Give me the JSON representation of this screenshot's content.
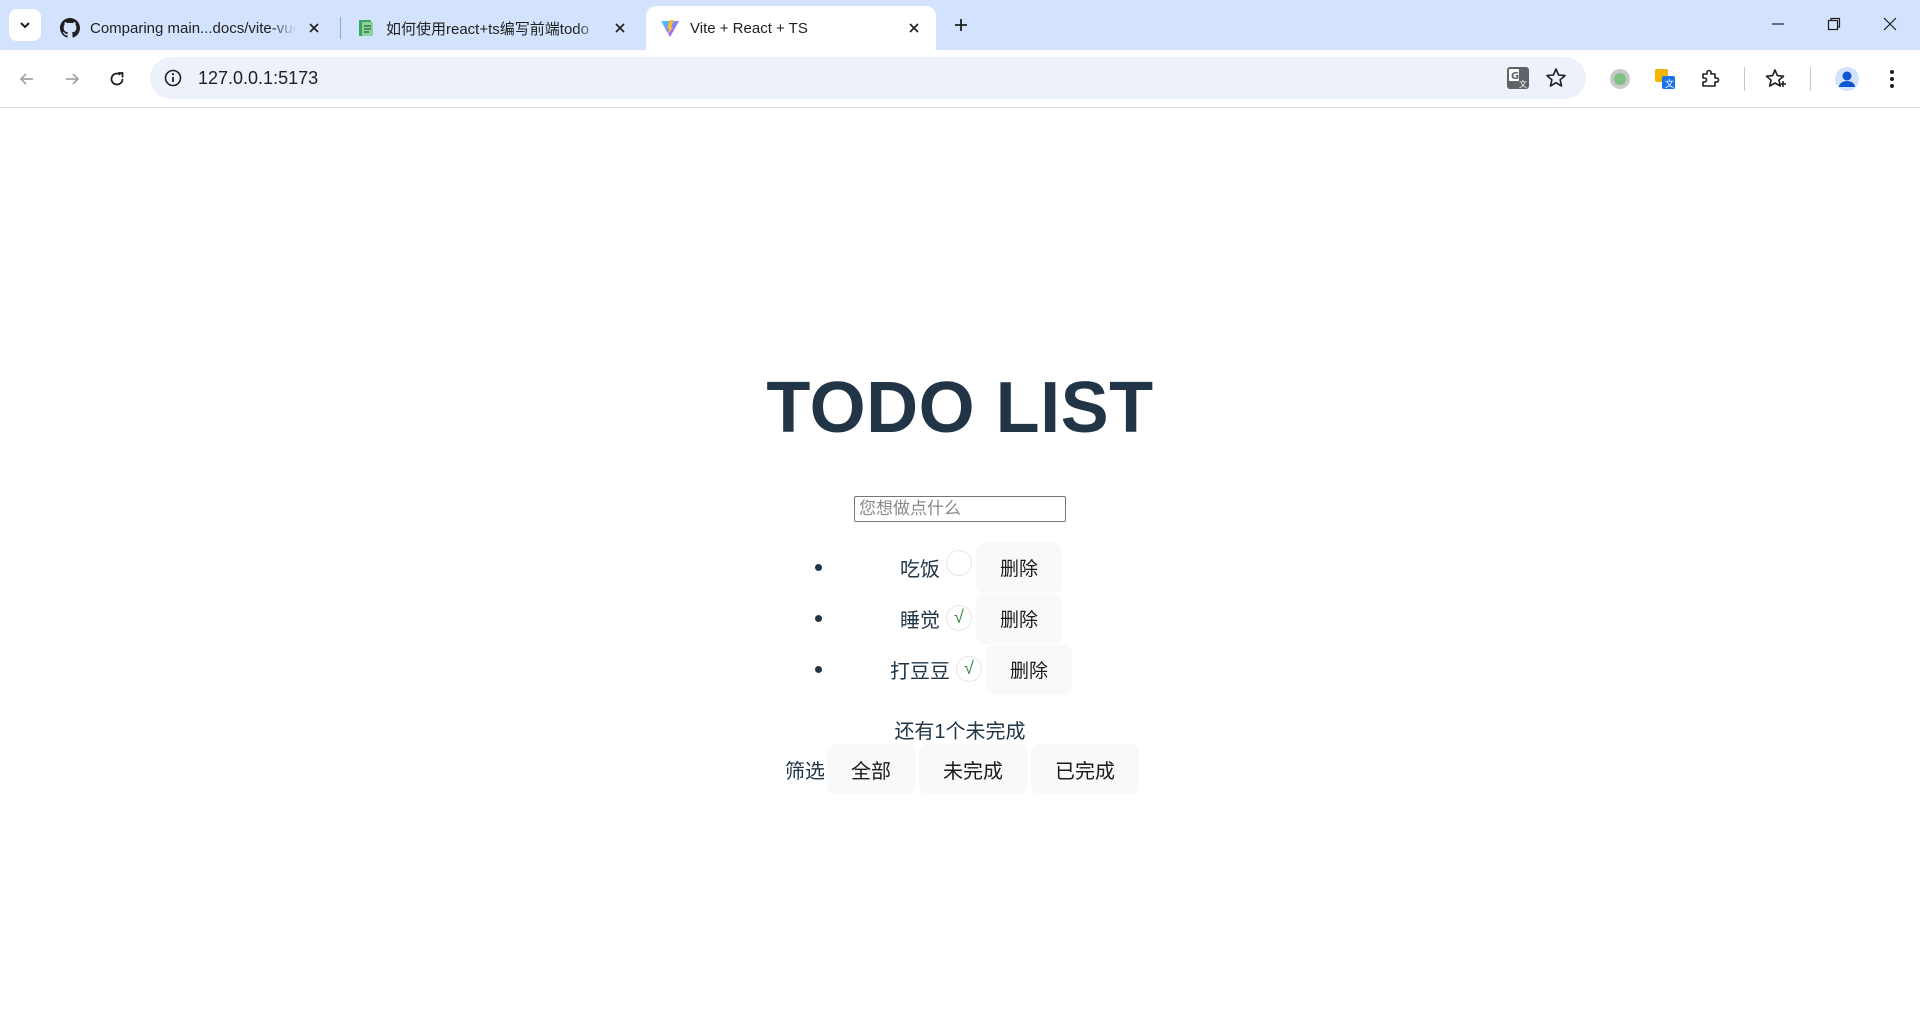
{
  "browser": {
    "tabs": [
      {
        "title": "Comparing main...docs/vite-vue3",
        "icon": "github-icon"
      },
      {
        "title": "如何使用react+ts编写前端todo",
        "icon": "article-icon"
      },
      {
        "title": "Vite + React + TS",
        "icon": "vite-icon",
        "active": true
      }
    ],
    "address": "127.0.0.1:5173"
  },
  "app": {
    "title": "TODO LIST",
    "input_placeholder": "您想做点什么",
    "todos": [
      {
        "text": "吃饭",
        "done": false,
        "check_mark": "",
        "delete_label": "删除"
      },
      {
        "text": "睡觉",
        "done": true,
        "check_mark": "√",
        "delete_label": "删除"
      },
      {
        "text": "打豆豆",
        "done": true,
        "check_mark": "√",
        "delete_label": "删除"
      }
    ],
    "remaining_text": "还有1个未完成",
    "filter": {
      "label": "筛选",
      "options": [
        "全部",
        "未完成",
        "已完成"
      ]
    }
  },
  "colors": {
    "tabstrip": "#d3e3fd",
    "omnibox": "#edf2fa",
    "text": "#213547",
    "button_bg": "#f9f9f9",
    "check": "#2e8b3a"
  }
}
